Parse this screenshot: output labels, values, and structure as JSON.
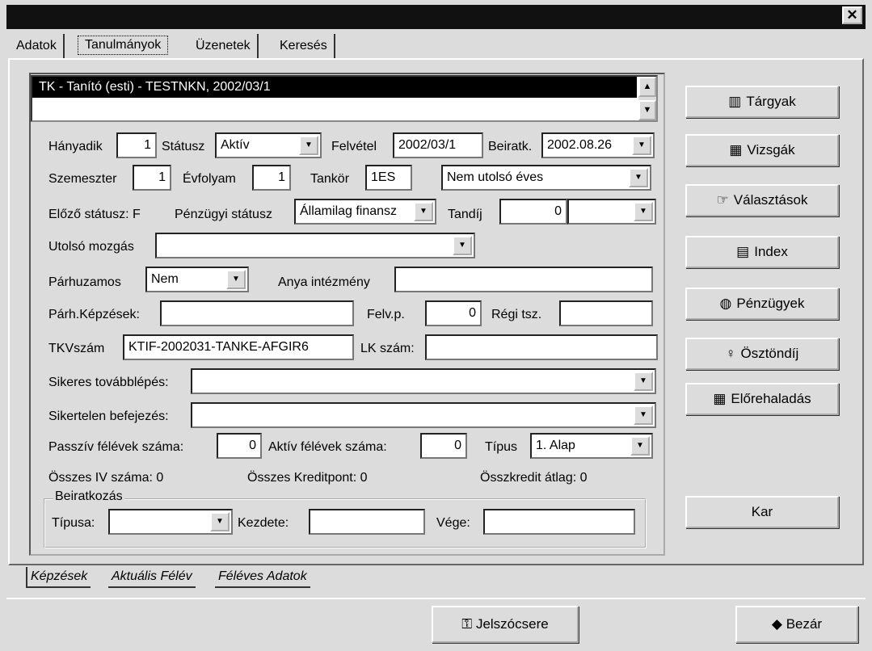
{
  "window": {
    "close_glyph": "✕"
  },
  "tabs": [
    {
      "label": "Adatok"
    },
    {
      "label": "Tanulmányok"
    },
    {
      "label": "Üzenetek"
    },
    {
      "label": "Keresés"
    }
  ],
  "list": {
    "selected": "TK - Tanító (esti) - TESTNKN, 2002/03/1"
  },
  "form": {
    "hanyadik_label": "Hányadik",
    "hanyadik": "1",
    "statusz_label": "Státusz",
    "statusz": "Aktív",
    "felvetel_label": "Felvétel",
    "felvetel": "2002/03/1",
    "beiratk_label": "Beiratk.",
    "beiratk": "2002.08.26",
    "szemeszter_label": "Szemeszter",
    "szemeszter": "1",
    "evfolyam_label": "Évfolyam",
    "evfolyam": "1",
    "tankor_label": "Tankör",
    "tankor": "1ES",
    "utolso_eves": "Nem utolsó éves",
    "elozo_statusz": "Előző státusz: F",
    "penzugyi_label": "Pénzügyi státusz",
    "penzugyi": "Államilag finansz",
    "tandij_label": "Tandíj",
    "tandij": "0",
    "tandij_dd": "",
    "utolso_mozgas_label": "Utolsó mozgás",
    "utolso_mozgas": "",
    "parhuzamos_label": "Párhuzamos",
    "parhuzamos": "Nem",
    "anya_label": "Anya intézmény",
    "anya": "",
    "parh_kepz_label": "Párh.Képzések:",
    "parh_kepz": "",
    "felvp_label": "Felv.p.",
    "felvp": "0",
    "regi_label": "Régi tsz.",
    "regi": "",
    "tkv_label": "TKVszám",
    "tkv": "KTIF-2002031-TANKE-AFGIR6",
    "lk_label": "LK szám:",
    "lk": "",
    "sikeres_label": "Sikeres továbblépés:",
    "sikeres": "",
    "sikertelen_label": "Sikertelen befejezés:",
    "sikertelen": "",
    "passziv_label": "Passzív félévek száma:",
    "passziv": "0",
    "aktiv_label": "Aktív félévek száma:",
    "aktiv": "0",
    "tipus_label": "Típus",
    "tipus": "1. Alap",
    "osszes_iv": "Összes IV száma: 0",
    "osszes_kredit": "Összes Kreditpont: 0",
    "osszkredit_atlag": "Összkredit átlag: 0"
  },
  "beiratkozas": {
    "title": "Beiratkozás",
    "tipusa_label": "Típusa:",
    "tipusa": "",
    "kezdete_label": "Kezdete:",
    "kezdete": "",
    "vege_label": "Vége:",
    "vege": ""
  },
  "side_buttons": [
    {
      "label": "Tárgyak",
      "icon": "books-icon"
    },
    {
      "label": "Vizsgák",
      "icon": "calculator-icon"
    },
    {
      "label": "Választások",
      "icon": "pointing-hand-icon"
    },
    {
      "label": "Index",
      "icon": "document-icon"
    },
    {
      "label": "Pénzügyek",
      "icon": "globe-icon"
    },
    {
      "label": "Ösztöndíj",
      "icon": "bulb-icon"
    },
    {
      "label": "Előrehaladás",
      "icon": "calendar-icon"
    },
    {
      "label": "Kar",
      "icon": ""
    }
  ],
  "bottom_tabs": [
    {
      "label": "Képzések"
    },
    {
      "label": "Aktuális Félév"
    },
    {
      "label": "Féléves Adatok"
    }
  ],
  "footer": {
    "jelszo": "Jelszócsere",
    "bezar": "Bezár"
  }
}
